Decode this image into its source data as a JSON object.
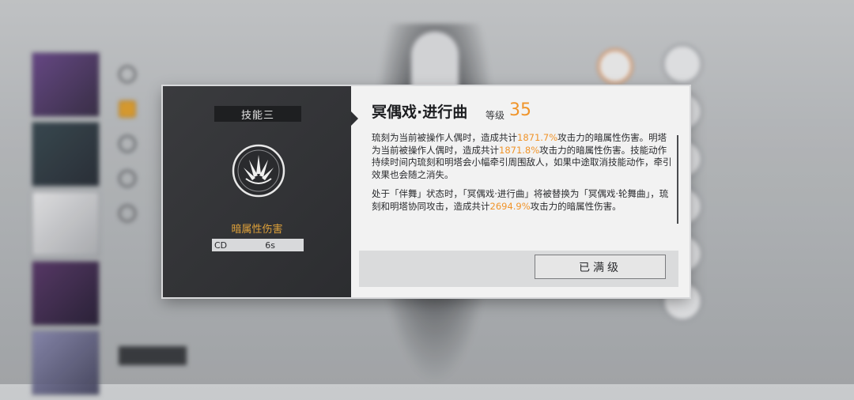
{
  "modal": {
    "skill_tag": "技能三",
    "damage_type": "暗属性伤害",
    "cd_label": "CD",
    "cd_value": "6s",
    "skill_name": "冥偶戏·进行曲",
    "level_label": "等级",
    "level_value": "35",
    "description": {
      "p1_a": "琉刻为当前被操作人偶时，造成共计",
      "p1_v1": "1871.7%",
      "p1_b": "攻击力的暗属性伤害。明塔为当前被操作人偶时，造成共计",
      "p1_v2": "1871.8%",
      "p1_c": "攻击力的暗属性伤害。技能动作持续时间内琉刻和明塔会小幅牵引周围敌人，如果中途取消技能动作，牵引效果也会随之消失。",
      "p2_a": "处于「伴舞」状态时，「冥偶戏·进行曲」将被替换为「冥偶戏·轮舞曲」，琉刻和明塔协同攻击，造成共计",
      "p2_v": "2694.9%",
      "p2_b": "攻击力的暗属性伤害。"
    },
    "max_button_label": "已满级"
  },
  "colors": {
    "accent_orange": "#f0942a",
    "panel_dark": "#2f3033",
    "panel_light": "#f2f2f2"
  }
}
